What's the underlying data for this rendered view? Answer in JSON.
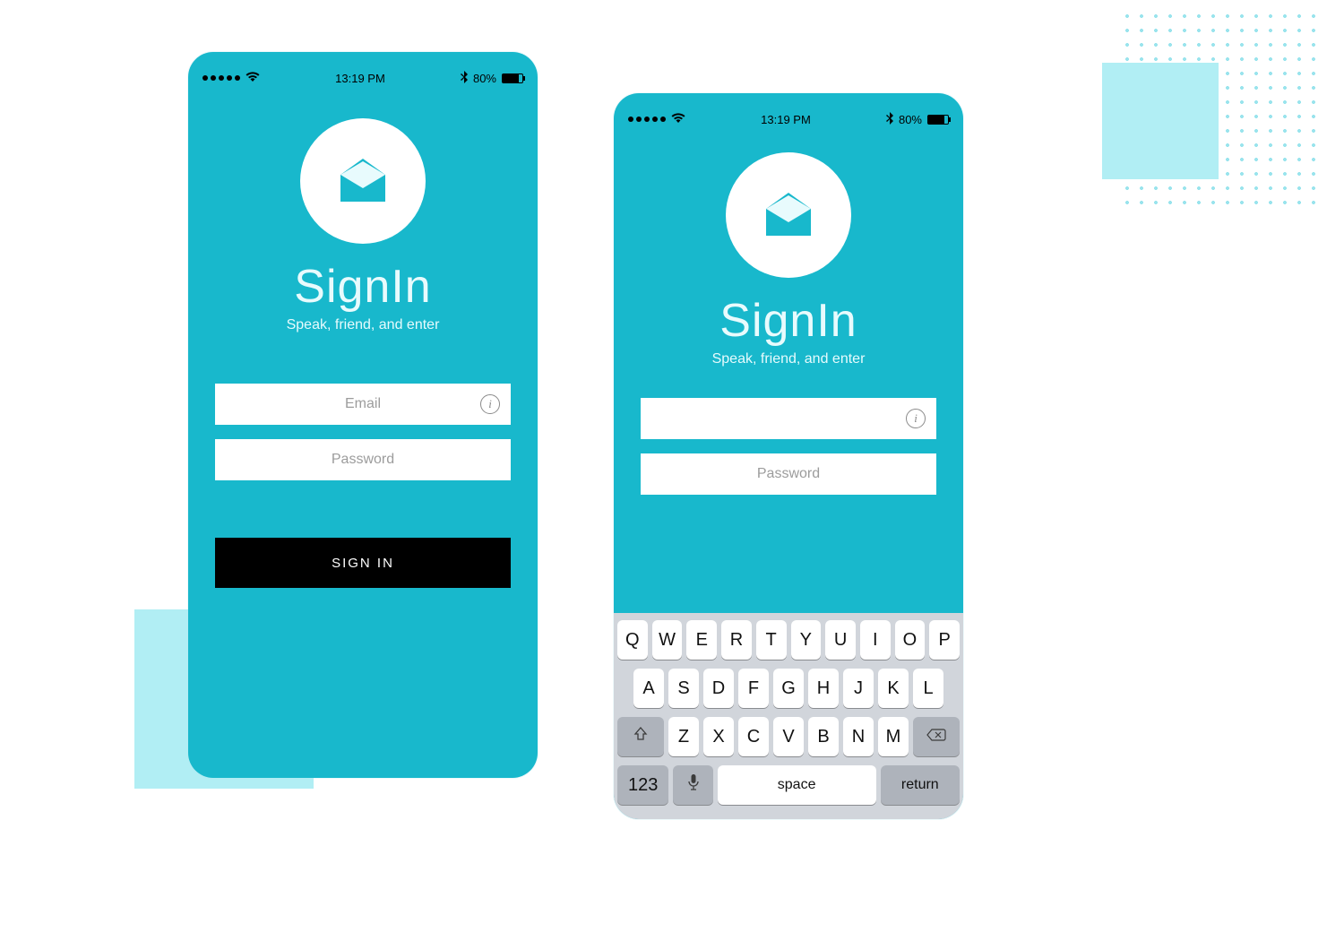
{
  "colors": {
    "brand": "#18b8cc",
    "accent": "#b1eef4"
  },
  "statusbar": {
    "time": "13:19 PM",
    "battery_pct": "80%"
  },
  "app": {
    "title": "SignIn",
    "subtitle": "Speak, friend, and enter"
  },
  "form": {
    "email_placeholder": "Email",
    "password_placeholder": "Password",
    "signin_button": "SIGN IN"
  },
  "keyboard": {
    "row1": [
      "Q",
      "W",
      "E",
      "R",
      "T",
      "Y",
      "U",
      "I",
      "O",
      "P"
    ],
    "row2": [
      "A",
      "S",
      "D",
      "F",
      "G",
      "H",
      "J",
      "K",
      "L"
    ],
    "row3": [
      "Z",
      "X",
      "C",
      "V",
      "B",
      "N",
      "M"
    ],
    "numeric_key": "123",
    "space_key": "space",
    "return_key": "return"
  }
}
